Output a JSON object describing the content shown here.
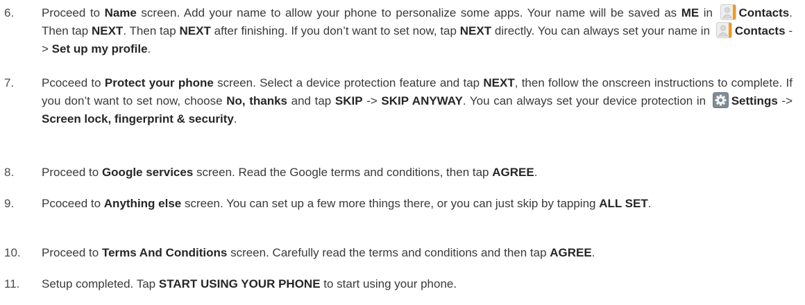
{
  "steps": [
    {
      "number": "6.",
      "parts": {
        "a": "Proceed to ",
        "b": "Name",
        "c": " screen. Add your name to allow your phone to personalize some apps. Your name will be saved as ",
        "d": "ME",
        "e": " in ",
        "f": "Contacts",
        "g": ". Then tap ",
        "h": "NEXT",
        "i": ". Then tap ",
        "j": "NEXT",
        "k": " after finishing. If you don’t want to set now, tap ",
        "l": "NEXT",
        "m": " directly. You can always set your name in ",
        "n": "Contacts",
        "o": " -> ",
        "p": "Set up my profile",
        "q": "."
      }
    },
    {
      "number": "7.",
      "parts": {
        "a": "Pcoceed to ",
        "b": "Protect your phone",
        "c": " screen. Select a device protection feature and tap ",
        "d": "NEXT",
        "e": ", then follow the onscreen instructions to complete. If you don’t want to set now, choose ",
        "f": "No, thanks",
        "g": " and tap ",
        "h": "SKIP",
        "i": " -> ",
        "j": "SKIP ANYWAY",
        "k": ". You can always set your device protection in ",
        "l": "Settings",
        "m": " -> ",
        "n": "Screen lock, fingerprint & security",
        "o": "."
      }
    },
    {
      "number": "8.",
      "parts": {
        "a": "Proceed to ",
        "b": "Google services",
        "c": " screen. Read the Google terms and conditions, then tap ",
        "d": "AGREE",
        "e": "."
      }
    },
    {
      "number": "9.",
      "parts": {
        "a": "Pcoceed to ",
        "b": "Anything else",
        "c": " screen. You can set up a few more things there, or you can just skip by tapping ",
        "d": "ALL SET",
        "e": "."
      }
    },
    {
      "number": "10.",
      "parts": {
        "a": "Proceed to ",
        "b": "Terms And Conditions",
        "c": " screen. Carefully read the terms and conditions and then tap ",
        "d": "AGREE",
        "e": "."
      }
    },
    {
      "number": "11.",
      "parts": {
        "a": "Setup completed. Tap ",
        "b": "START USING YOUR PHONE",
        "c": " to start using your phone."
      }
    }
  ],
  "icons": {
    "contacts": "contacts-app-icon",
    "settings": "settings-gear-icon"
  }
}
